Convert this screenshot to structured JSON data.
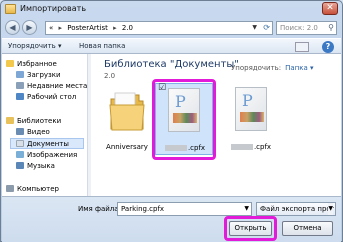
{
  "window": {
    "title": "Импортировать",
    "close_label": "✕"
  },
  "nav": {
    "back_glyph": "◀",
    "forward_glyph": "▶",
    "address_segments": [
      "PosterArtist",
      "2.0"
    ],
    "address_prefix": "«",
    "address_sep": "▸",
    "search_placeholder": "Поиск: 2.0",
    "search_icon": "magnifier-icon"
  },
  "toolbar": {
    "organize_label": "Упорядочить ▾",
    "new_folder_label": "Новая папка"
  },
  "sidebar": {
    "favorites": "Избранное",
    "downloads": "Загрузки",
    "recent": "Недавние места",
    "desktop": "Рабочий стол",
    "libraries": "Библиотеки",
    "video": "Видео",
    "documents": "Документы",
    "images": "Изображения",
    "music": "Музыка",
    "computer": "Компьютер"
  },
  "main": {
    "library_title": "Библиотека \"Документы\"",
    "library_subtitle": "2.0",
    "arrange_label": "Упорядочить:",
    "arrange_value": "Папка ▾",
    "files": [
      {
        "label": "Anniversary",
        "kind": "folder"
      },
      {
        "label": ".cpfx",
        "kind": "document",
        "selected": true,
        "checkbox": "☑"
      },
      {
        "label": ".cpfx",
        "kind": "document"
      }
    ]
  },
  "bottom": {
    "filename_label": "Имя файла:",
    "filename_value": "Parking.cpfx",
    "filter_value": "Файл экспорта программы Р",
    "open_label": "Открыть",
    "cancel_label": "Отмена"
  },
  "colors": {
    "highlight": "#e21bd8",
    "accent": "#3c79c5"
  }
}
